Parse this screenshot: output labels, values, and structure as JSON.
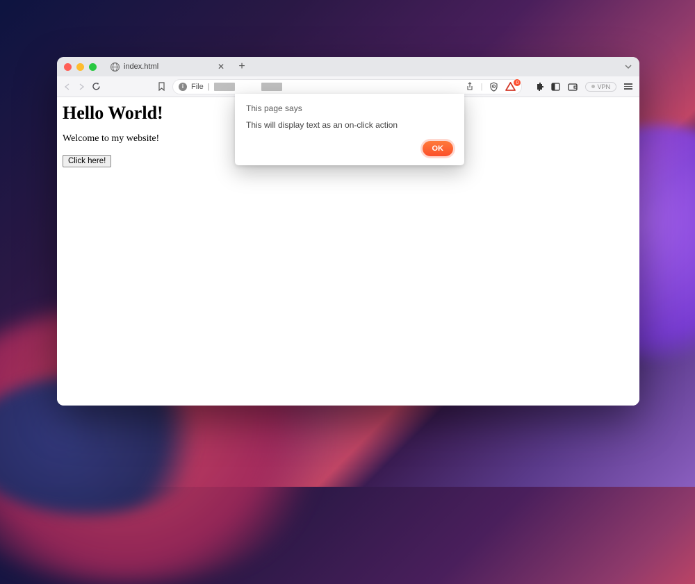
{
  "tab": {
    "title": "index.html"
  },
  "address": {
    "scheme": "File"
  },
  "toolbar": {
    "vpn_label": "VPN",
    "badge_count": "0"
  },
  "page": {
    "heading": "Hello World!",
    "intro": "Welcome to my website!",
    "button_label": "Click here!"
  },
  "dialog": {
    "title": "This page says",
    "message": "This will display text as an on-click action",
    "ok_label": "OK"
  }
}
